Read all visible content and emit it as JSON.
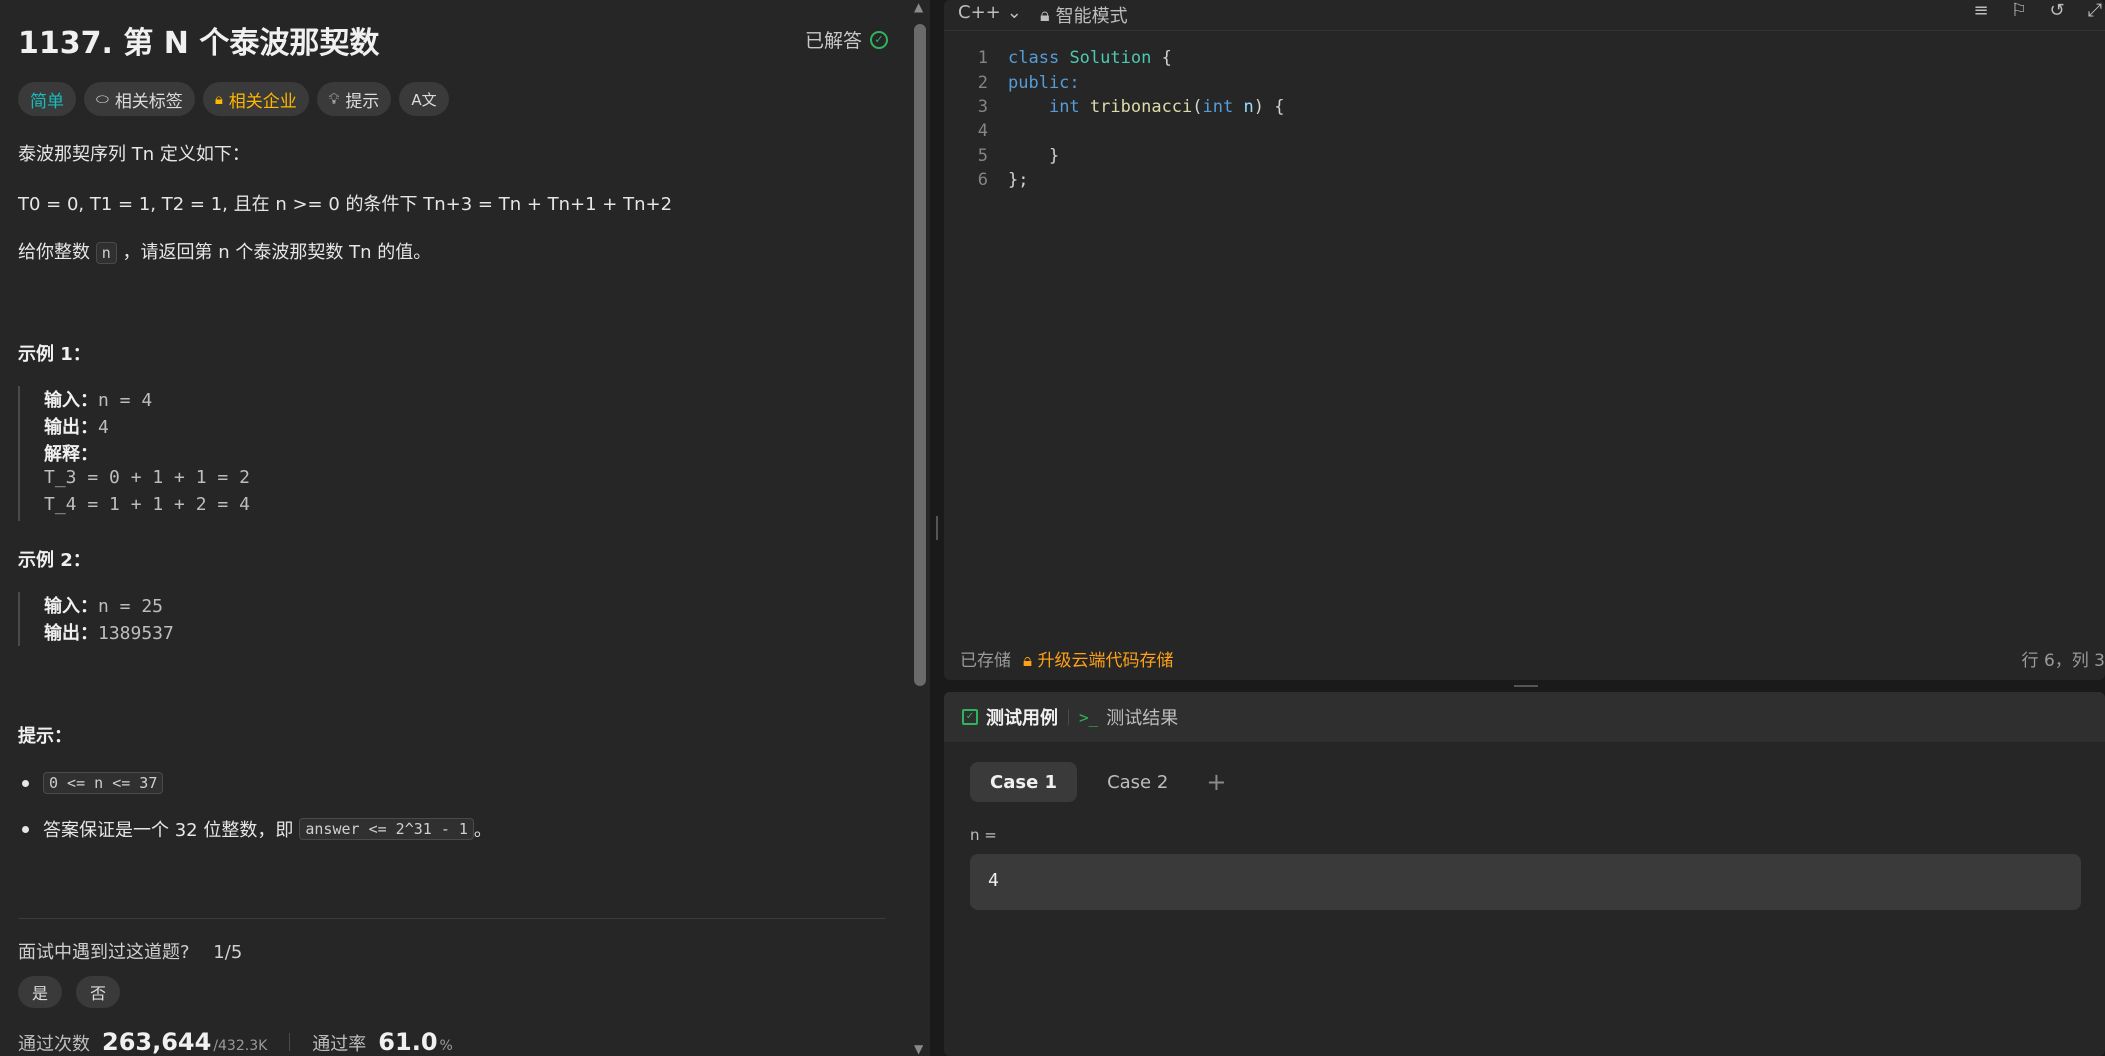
{
  "problem": {
    "title": "1137. 第 N 个泰波那契数",
    "status": "已解答",
    "tags": {
      "difficulty": "简单",
      "related_tags": "相关标签",
      "related_companies": "相关企业",
      "hint": "提示",
      "translate": "A文"
    },
    "intro": "泰波那契序列 Tn 定义如下：",
    "definition": {
      "base": "T0 = 0, T1 = 1, T2 = 1, 且在 n >= 0 的条件下",
      "recurrence": "Tn+3 = Tn + Tn+1 + Tn+2"
    },
    "task_prefix": "给你整数",
    "task_var": "n",
    "task_suffix": "，请返回第 n 个泰波那契数 Tn 的值。",
    "example1": {
      "heading": "示例 1：",
      "input_label": "输入：",
      "input_value": "n = 4",
      "output_label": "输出：",
      "output_value": "4",
      "explain_label": "解释：",
      "explain_line1": "T_3 = 0 + 1 + 1 = 2",
      "explain_line2": "T_4 = 1 + 1 + 2 = 4"
    },
    "example2": {
      "heading": "示例 2：",
      "input_label": "输入：",
      "input_value": "n = 25",
      "output_label": "输出：",
      "output_value": "1389537"
    },
    "hints_heading": "提示：",
    "hint1_code": "0 <= n <= 37",
    "hint2_text": "答案保证是一个 32 位整数，即",
    "hint2_code": "answer <= 2^31 - 1",
    "hint2_end": "。",
    "interview_question": "面试中遇到过这道题?",
    "interview_count": "1/5",
    "yes": "是",
    "no": "否",
    "accepted_label": "通过次数",
    "accepted_value": "263,644",
    "submissions_value": "/432.3K",
    "rate_label": "通过率",
    "rate_value": "61.0",
    "rate_unit": "%"
  },
  "editor": {
    "language": "C++",
    "mode": "智能模式",
    "saved": "已存储",
    "upgrade": "升级云端代码存储",
    "cursor": "行 6，列 3",
    "line_numbers": [
      "1",
      "2",
      "3",
      "4",
      "5",
      "6"
    ],
    "code": {
      "l1_kw": "class",
      "l1_cls": "Solution",
      "l1_brace": " {",
      "l2": "public:",
      "l3_kw": "int",
      "l3_fn": "tribonacci",
      "l3_open": "(",
      "l3_ptype": "int",
      "l3_pname": "n",
      "l3_close": ") {",
      "l5": "}",
      "l6": "};"
    }
  },
  "testcase": {
    "tab_cases": "测试用例",
    "tab_results": "测试结果",
    "case1": "Case 1",
    "case2": "Case 2",
    "add": "+",
    "var_label": "n =",
    "var_value": "4"
  }
}
